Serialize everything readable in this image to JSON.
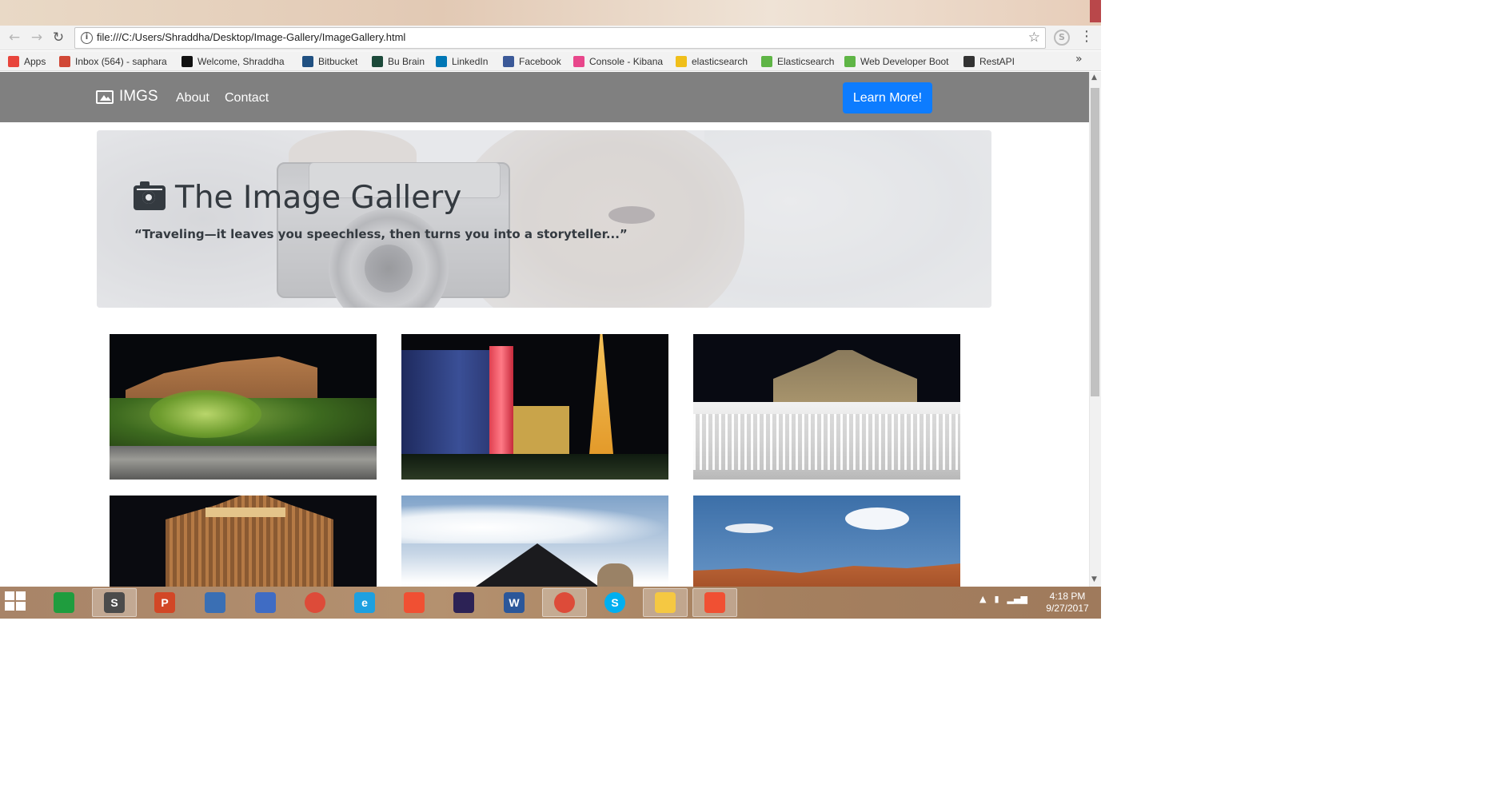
{
  "browser": {
    "url": "file:///C:/Users/Shraddha/Desktop/Image-Gallery/ImageGallery.html",
    "bookmarks": [
      {
        "label": "Apps",
        "icon": "apps-grid-icon",
        "color": "#e8453c"
      },
      {
        "label": "Inbox (564) - saphara",
        "icon": "gmail-icon",
        "color": "#d14836"
      },
      {
        "label": "Welcome, Shraddha",
        "icon": "bb-icon",
        "color": "#111111"
      },
      {
        "label": "Bitbucket",
        "icon": "bitbucket-icon",
        "color": "#205081"
      },
      {
        "label": "Bu Brain",
        "icon": "bu-brain-icon",
        "color": "#1c4a3a"
      },
      {
        "label": "LinkedIn",
        "icon": "linkedin-icon",
        "color": "#0077b5"
      },
      {
        "label": "Facebook",
        "icon": "facebook-icon",
        "color": "#3b5998"
      },
      {
        "label": "Console - Kibana",
        "icon": "kibana-icon",
        "color": "#e8478b"
      },
      {
        "label": "elasticsearch",
        "icon": "elastic-icon",
        "color": "#f0bf1a"
      },
      {
        "label": "Elasticsearch",
        "icon": "udemy-icon",
        "color": "#5fb546"
      },
      {
        "label": "Web Developer Boot",
        "icon": "udemy-icon",
        "color": "#5fb546"
      },
      {
        "label": "RestAPI",
        "icon": "jb-icon",
        "color": "#333333"
      }
    ],
    "more_label": "»"
  },
  "site": {
    "brand": "IMGS",
    "nav": {
      "about": "About",
      "contact": "Contact"
    },
    "cta": "Learn More!",
    "cta_color": "#0d7cff",
    "navbar_color": "#808080",
    "jumbotron": {
      "title": "The Image Gallery",
      "quote": "“Traveling—it leaves you speechless, then turns you into a storyteller...”"
    },
    "gallery": [
      {
        "name": "mirage-night",
        "icon": "photo-mirage"
      },
      {
        "name": "paris-eiffel-night",
        "icon": "photo-paris"
      },
      {
        "name": "bellagio-fountains",
        "icon": "photo-bellagio"
      },
      {
        "name": "mandalay-bay",
        "icon": "photo-mandalay"
      },
      {
        "name": "luxor-pyramid",
        "icon": "photo-luxor"
      },
      {
        "name": "red-rock-canyon",
        "icon": "photo-canyon"
      }
    ]
  },
  "taskbar": {
    "apps": [
      {
        "name": "store",
        "letter": "",
        "color": "#1f9d3e"
      },
      {
        "name": "sublime-text",
        "letter": "S",
        "color": "#4b4b4b",
        "active": true
      },
      {
        "name": "powerpoint",
        "letter": "P",
        "color": "#d24726"
      },
      {
        "name": "network-tool",
        "letter": "",
        "color": "#3a6fb4"
      },
      {
        "name": "remote-desktop",
        "letter": "",
        "color": "#3f6cc4"
      },
      {
        "name": "chrome",
        "letter": "",
        "color": "#dd4b39"
      },
      {
        "name": "internet-explorer",
        "letter": "e",
        "color": "#1ea0e0"
      },
      {
        "name": "git",
        "letter": "",
        "color": "#f05033"
      },
      {
        "name": "eclipse",
        "letter": "",
        "color": "#2c2255"
      },
      {
        "name": "word",
        "letter": "W",
        "color": "#2b579a"
      },
      {
        "name": "chrome-active",
        "letter": "",
        "color": "#dd4b39",
        "active": true
      },
      {
        "name": "skype",
        "letter": "S",
        "color": "#00aff0"
      },
      {
        "name": "file-explorer",
        "letter": "",
        "color": "#f5c842",
        "active": true
      },
      {
        "name": "git-2",
        "letter": "",
        "color": "#f05033",
        "active": true
      }
    ],
    "time": "4:18 PM",
    "date": "9/27/2017"
  }
}
